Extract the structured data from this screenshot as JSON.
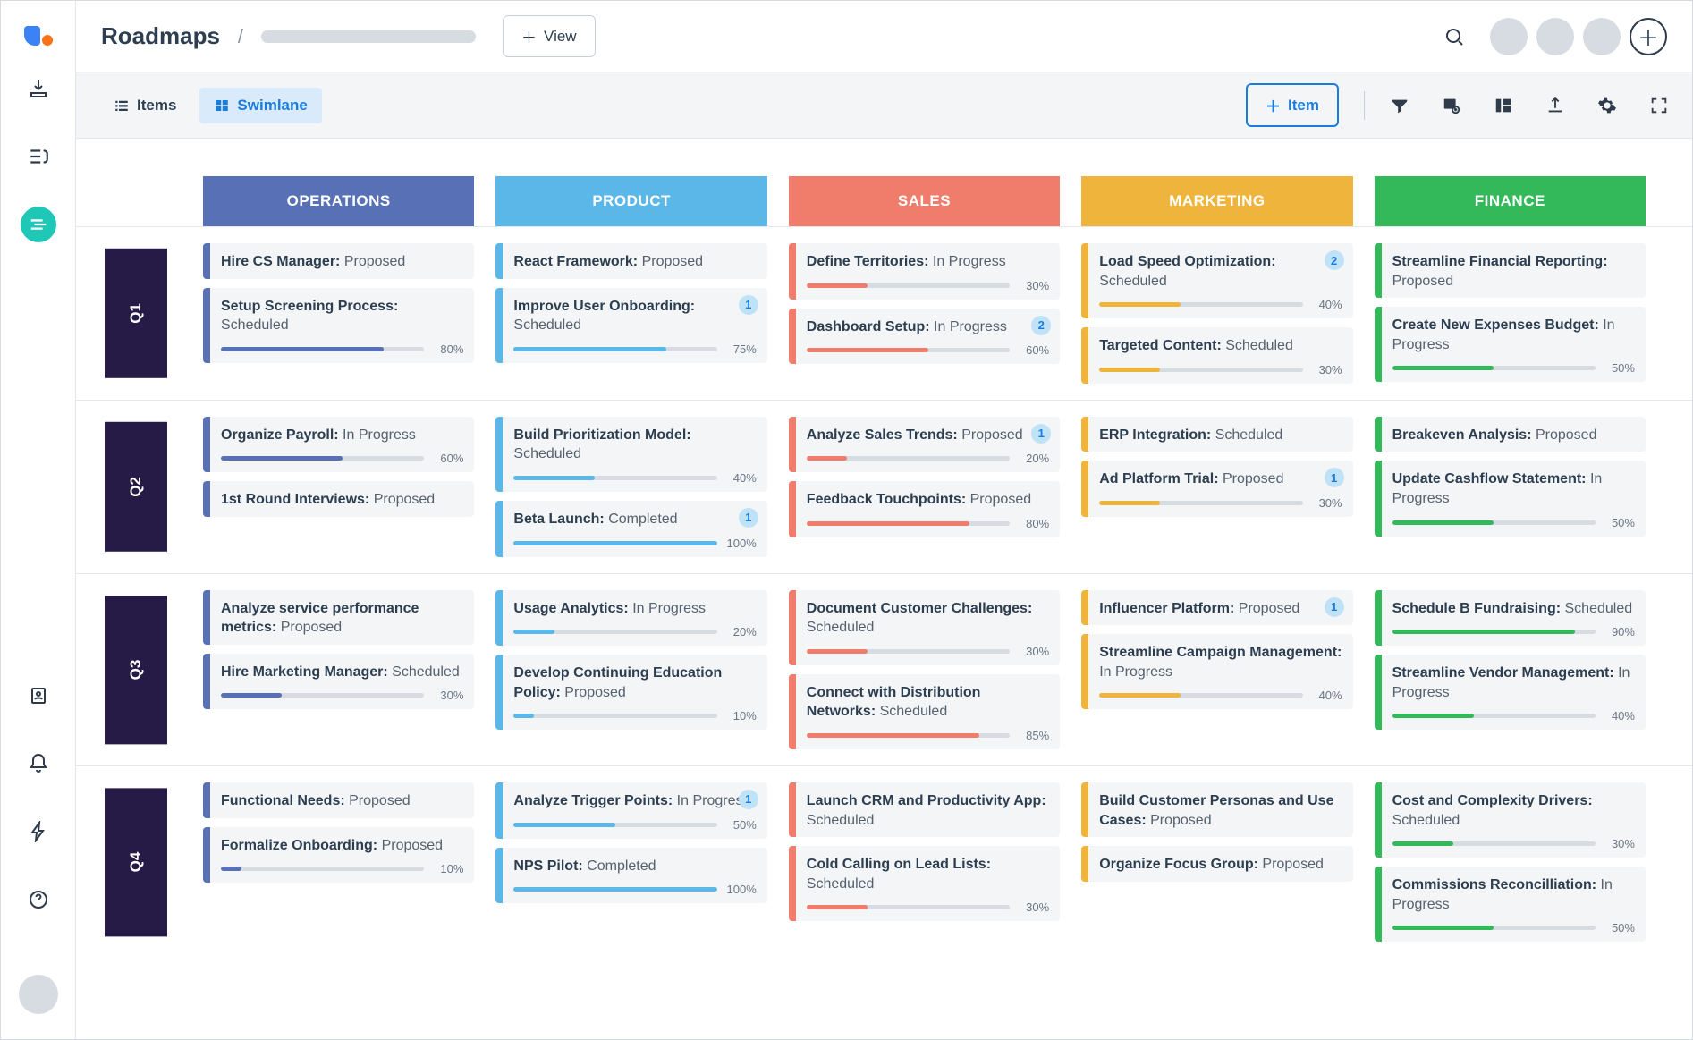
{
  "page_title": "Roadmaps",
  "view_button": "View",
  "tabs": {
    "items": "Items",
    "swimlane": "Swimlane"
  },
  "add_item_button": "Item",
  "columns": [
    {
      "key": "operations",
      "label": "OPERATIONS",
      "color": "#5870b5"
    },
    {
      "key": "product",
      "label": "PRODUCT",
      "color": "#5ab7e8"
    },
    {
      "key": "sales",
      "label": "SALES",
      "color": "#f07c6c"
    },
    {
      "key": "marketing",
      "label": "MARKETING",
      "color": "#efb43b"
    },
    {
      "key": "finance",
      "label": "FINANCE",
      "color": "#33b85a"
    }
  ],
  "row_labels": [
    "Q1",
    "Q2",
    "Q3",
    "Q4"
  ],
  "board": [
    [
      [
        {
          "title": "Hire CS Manager:",
          "status": "Proposed"
        },
        {
          "title": "Setup Screening Process:",
          "status": "Scheduled",
          "pct": 80
        }
      ],
      [
        {
          "title": "React Framework:",
          "status": "Proposed"
        },
        {
          "title": "Improve User Onboarding:",
          "status": "Scheduled",
          "pct": 75,
          "badge": 1
        }
      ],
      [
        {
          "title": "Define Territories:",
          "status": "In Progress",
          "pct": 30
        },
        {
          "title": "Dashboard Setup:",
          "status": "In Progress",
          "pct": 60,
          "badge": 2
        }
      ],
      [
        {
          "title": "Load Speed Optimization:",
          "status": "Scheduled",
          "pct": 40,
          "badge": 2
        },
        {
          "title": "Targeted Content:",
          "status": "Scheduled",
          "pct": 30
        }
      ],
      [
        {
          "title": "Streamline Financial Reporting:",
          "status": "Proposed"
        },
        {
          "title": "Create New Expenses Budget:",
          "status": "In Progress",
          "pct": 50
        }
      ]
    ],
    [
      [
        {
          "title": "Organize Payroll:",
          "status": "In Progress",
          "pct": 60
        },
        {
          "title": "1st Round Interviews:",
          "status": "Proposed"
        }
      ],
      [
        {
          "title": "Build Prioritization Model:",
          "status": "Scheduled",
          "pct": 40
        },
        {
          "title": "Beta Launch:",
          "status": "Completed",
          "pct": 100,
          "badge": 1
        }
      ],
      [
        {
          "title": "Analyze Sales Trends:",
          "status": "Proposed",
          "pct": 20,
          "badge": 1
        },
        {
          "title": "Feedback Touchpoints:",
          "status": "Proposed",
          "pct": 80
        }
      ],
      [
        {
          "title": "ERP Integration:",
          "status": "Scheduled"
        },
        {
          "title": "Ad Platform Trial:",
          "status": "Proposed",
          "pct": 30,
          "badge": 1
        }
      ],
      [
        {
          "title": "Breakeven Analysis:",
          "status": "Proposed"
        },
        {
          "title": "Update Cashflow Statement:",
          "status": "In Progress",
          "pct": 50
        }
      ]
    ],
    [
      [
        {
          "title": "Analyze service performance metrics:",
          "status": "Proposed"
        },
        {
          "title": "Hire Marketing Manager:",
          "status": "Scheduled",
          "pct": 30
        }
      ],
      [
        {
          "title": "Usage Analytics:",
          "status": "In Progress",
          "pct": 20
        },
        {
          "title": "Develop Continuing Education Policy:",
          "status": "Proposed",
          "pct": 10
        }
      ],
      [
        {
          "title": "Document Customer Challenges:",
          "status": "Scheduled",
          "pct": 30
        },
        {
          "title": "Connect with Distribution Networks:",
          "status": "Scheduled",
          "pct": 85
        }
      ],
      [
        {
          "title": "Influencer Platform:",
          "status": "Proposed",
          "badge": 1
        },
        {
          "title": "Streamline Campaign Management:",
          "status": "In Progress",
          "pct": 40
        }
      ],
      [
        {
          "title": "Schedule B Fundraising:",
          "status": "Scheduled",
          "pct": 90
        },
        {
          "title": "Streamline Vendor Management:",
          "status": "In Progress",
          "pct": 40
        }
      ]
    ],
    [
      [
        {
          "title": "Functional Needs:",
          "status": "Proposed"
        },
        {
          "title": "Formalize Onboarding:",
          "status": "Proposed",
          "pct": 10
        }
      ],
      [
        {
          "title": "Analyze Trigger Points:",
          "status": "In Progress",
          "pct": 50,
          "badge": 1
        },
        {
          "title": "NPS Pilot:",
          "status": "Completed",
          "pct": 100
        }
      ],
      [
        {
          "title": "Launch CRM and Productivity App:",
          "status": "Scheduled"
        },
        {
          "title": "Cold Calling on Lead Lists:",
          "status": "Scheduled",
          "pct": 30
        }
      ],
      [
        {
          "title": "Build Customer Personas and Use Cases:",
          "status": "Proposed"
        },
        {
          "title": "Organize Focus Group:",
          "status": "Proposed"
        }
      ],
      [
        {
          "title": "Cost and Complexity Drivers:",
          "status": "Scheduled",
          "pct": 30
        },
        {
          "title": "Commissions Reconcilliation:",
          "status": "In Progress",
          "pct": 50
        }
      ]
    ]
  ]
}
